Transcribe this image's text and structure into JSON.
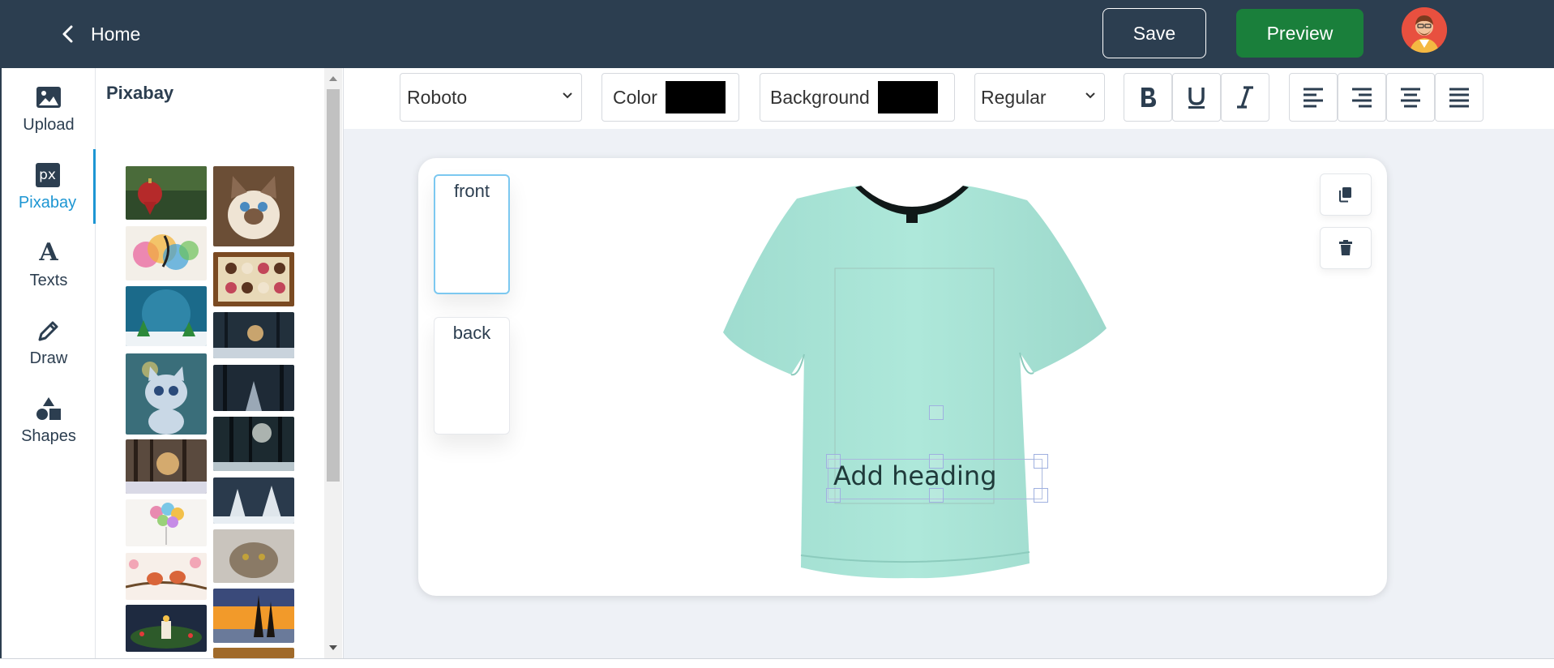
{
  "header": {
    "home_label": "Home",
    "save_label": "Save",
    "preview_label": "Preview"
  },
  "rail": {
    "items": [
      {
        "label": "Upload",
        "icon": "image-icon"
      },
      {
        "label": "Pixabay",
        "icon": "pixabay-icon",
        "icon_text": "px"
      },
      {
        "label": "Texts",
        "icon": "text-a-icon",
        "icon_text": "A"
      },
      {
        "label": "Draw",
        "icon": "pencil-icon"
      },
      {
        "label": "Shapes",
        "icon": "shapes-icon"
      }
    ],
    "active": "Pixabay"
  },
  "panel": {
    "title": "Pixabay",
    "thumbnails": [
      "christmas-ornament",
      "siamese-kitten",
      "music-notes",
      "chocolate-box",
      "christmas-globe",
      "snowy-forest-night",
      "cartoon-kitten",
      "dark-forest-path",
      "winter-forest-sunset",
      "sunbeam-forest",
      "heart-balloons",
      "snowy-trees",
      "birds-on-branch",
      "tabby-cat",
      "christmas-candles",
      "winter-sunset-trees"
    ]
  },
  "toolbar": {
    "font_value": "Roboto",
    "color_label": "Color",
    "color_value": "#000000",
    "background_label": "Background",
    "background_value": "#000000",
    "weight_value": "Regular"
  },
  "canvas": {
    "sides": [
      "front",
      "back"
    ],
    "active_side": "front",
    "shirt_color": "#a8e6d8",
    "text_object": "Add heading"
  },
  "colors": {
    "header_bg": "#2c3e50",
    "accent": "#1d96d3",
    "preview_green": "#1a7f3b"
  }
}
